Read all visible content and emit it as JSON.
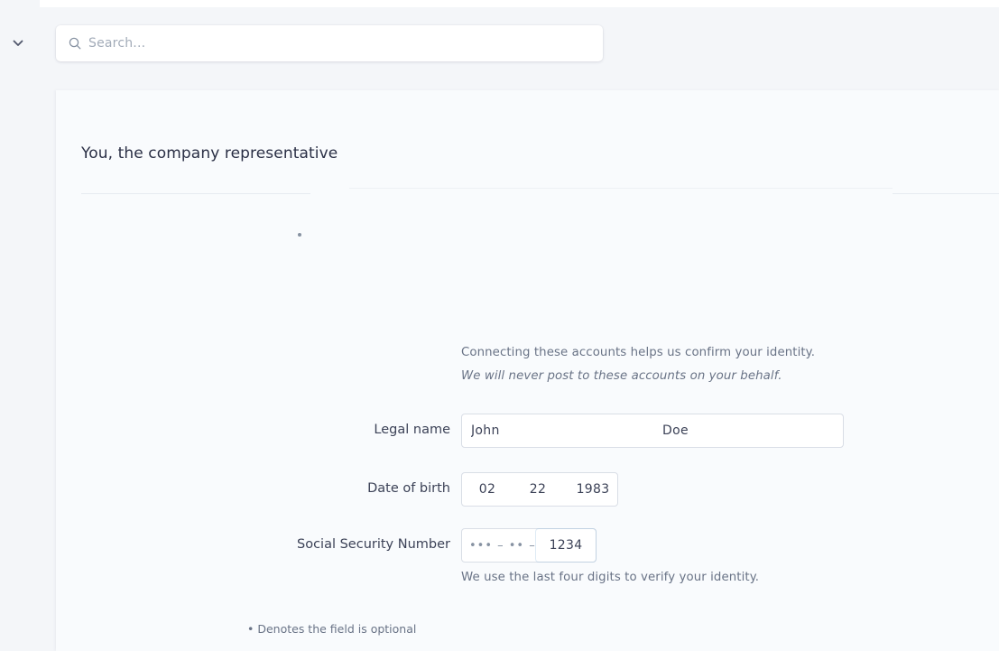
{
  "search": {
    "placeholder": "Search...",
    "value": ""
  },
  "card": {
    "title": "You, the company representative",
    "connect_help": "Connecting these accounts helps us confirm your identity.",
    "connect_note": "We will never post to these accounts on your behalf."
  },
  "form": {
    "legal_name": {
      "label": "Legal name",
      "first": "John",
      "last": "Doe"
    },
    "date_of_birth": {
      "label": "Date of birth",
      "month": "02",
      "day": "22",
      "year": "1983"
    },
    "ssn": {
      "label": "Social Security Number",
      "masked": "••• – •• –",
      "last_four": "1234",
      "help": "We use the last four digits to verify your identity."
    },
    "optional_note": "• Denotes the field is optional"
  },
  "icons": {
    "collapse": "chevron-down-icon",
    "search": "search-icon"
  }
}
